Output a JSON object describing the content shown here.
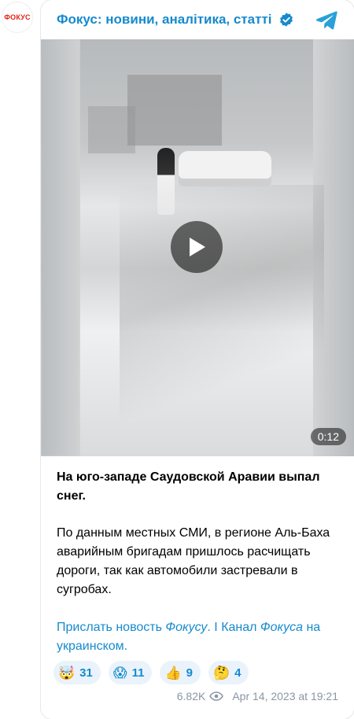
{
  "avatar": {
    "label": "ФОКУС"
  },
  "header": {
    "channel_name": "Фокус: новини, аналітика, статті",
    "verified_icon": "verified-check-icon",
    "platform_icon": "telegram-icon"
  },
  "video": {
    "duration": "0:12",
    "play_icon": "play-icon"
  },
  "post": {
    "title": "На юго-западе Саудовской Аравии выпал снег.",
    "body": "По данным местных СМИ, в регионе Аль-Баха аварийным бригадам пришлось расчищать дороги, так как автомобили застревали в сугробах.",
    "link1_prefix": "Прислать новость ",
    "link1_italic": "Фокусу",
    "link1_suffix": ".",
    "separator": " I ",
    "link2_prefix": "Канал ",
    "link2_italic": "Фокуса",
    "link2_suffix": " на украинском."
  },
  "reactions": [
    {
      "emoji": "🤯",
      "count": "31"
    },
    {
      "emoji": "😱",
      "count": "11"
    },
    {
      "emoji": "👍",
      "count": "9"
    },
    {
      "emoji": "🤔",
      "count": "4"
    }
  ],
  "meta": {
    "views": "6.82K",
    "timestamp": "Apr 14, 2023 at 19:21"
  },
  "colors": {
    "accent": "#168acd",
    "brand_red": "#e2231a",
    "meta_gray": "#8a96a3"
  }
}
